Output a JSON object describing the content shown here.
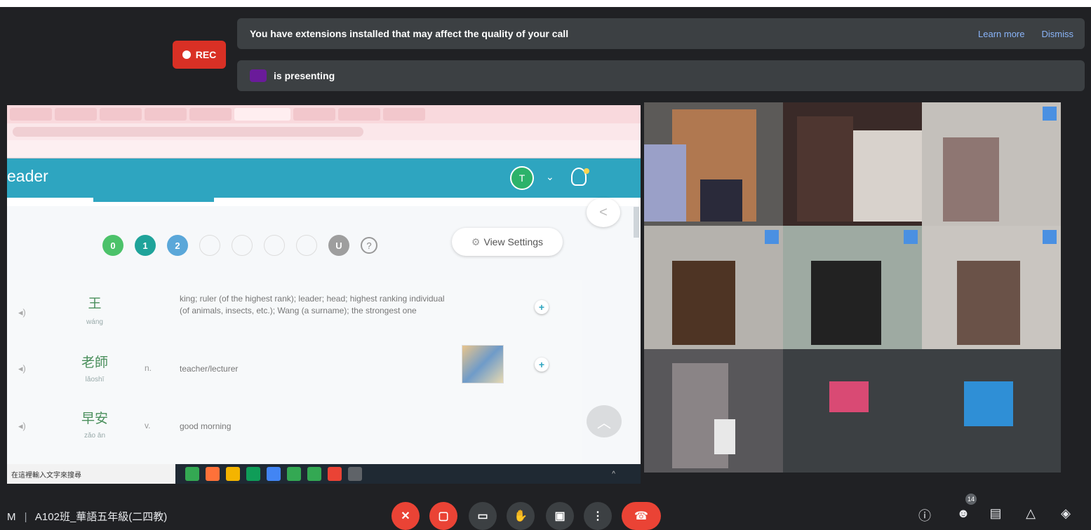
{
  "recording": {
    "label": "REC"
  },
  "notices": {
    "extensions": {
      "message": "You have extensions installed that may affect the quality of your call",
      "learn_more": "Learn more",
      "dismiss": "Dismiss"
    },
    "presenting": {
      "presenter_initials": "",
      "message": "is presenting"
    }
  },
  "presentation": {
    "app_title": "eader",
    "avatar_letter": "T",
    "view_settings": "View Settings",
    "help_label": "?",
    "levels": [
      {
        "label": "0",
        "color": "#4cc26a"
      },
      {
        "label": "1",
        "color": "#1fa39a"
      },
      {
        "label": "2",
        "color": "#5aa7d9"
      },
      {
        "label": "",
        "color": ""
      },
      {
        "label": "",
        "color": ""
      },
      {
        "label": "",
        "color": ""
      },
      {
        "label": "",
        "color": ""
      },
      {
        "label": "U",
        "color": "#9e9e9e"
      }
    ],
    "vocabulary": [
      {
        "hanzi": "王",
        "pinyin": "wáng",
        "pos": "",
        "definition": "king; ruler (of the highest rank); leader; head; highest ranking individual (of animals, insects, etc.); Wang (a surname); the strongest one",
        "has_image": false
      },
      {
        "hanzi": "老師",
        "pinyin": "lǎoshī",
        "pos": "n.",
        "definition": "teacher/lecturer",
        "has_image": true
      },
      {
        "hanzi": "早安",
        "pinyin": "zǎo ān",
        "pos": "v.",
        "definition": "good morning",
        "has_image": false
      }
    ],
    "taskbar": {
      "search_placeholder": "在這裡輸入文字來搜尋"
    }
  },
  "meeting": {
    "time_suffix": "M",
    "separator": "|",
    "title": "A102班_華語五年級(二四教)",
    "participant_count": "14"
  },
  "colors": {
    "meet_bg": "#202124",
    "danger": "#ea4335",
    "accent_link": "#8ab4f8",
    "reader_teal": "#2ea5c0"
  }
}
